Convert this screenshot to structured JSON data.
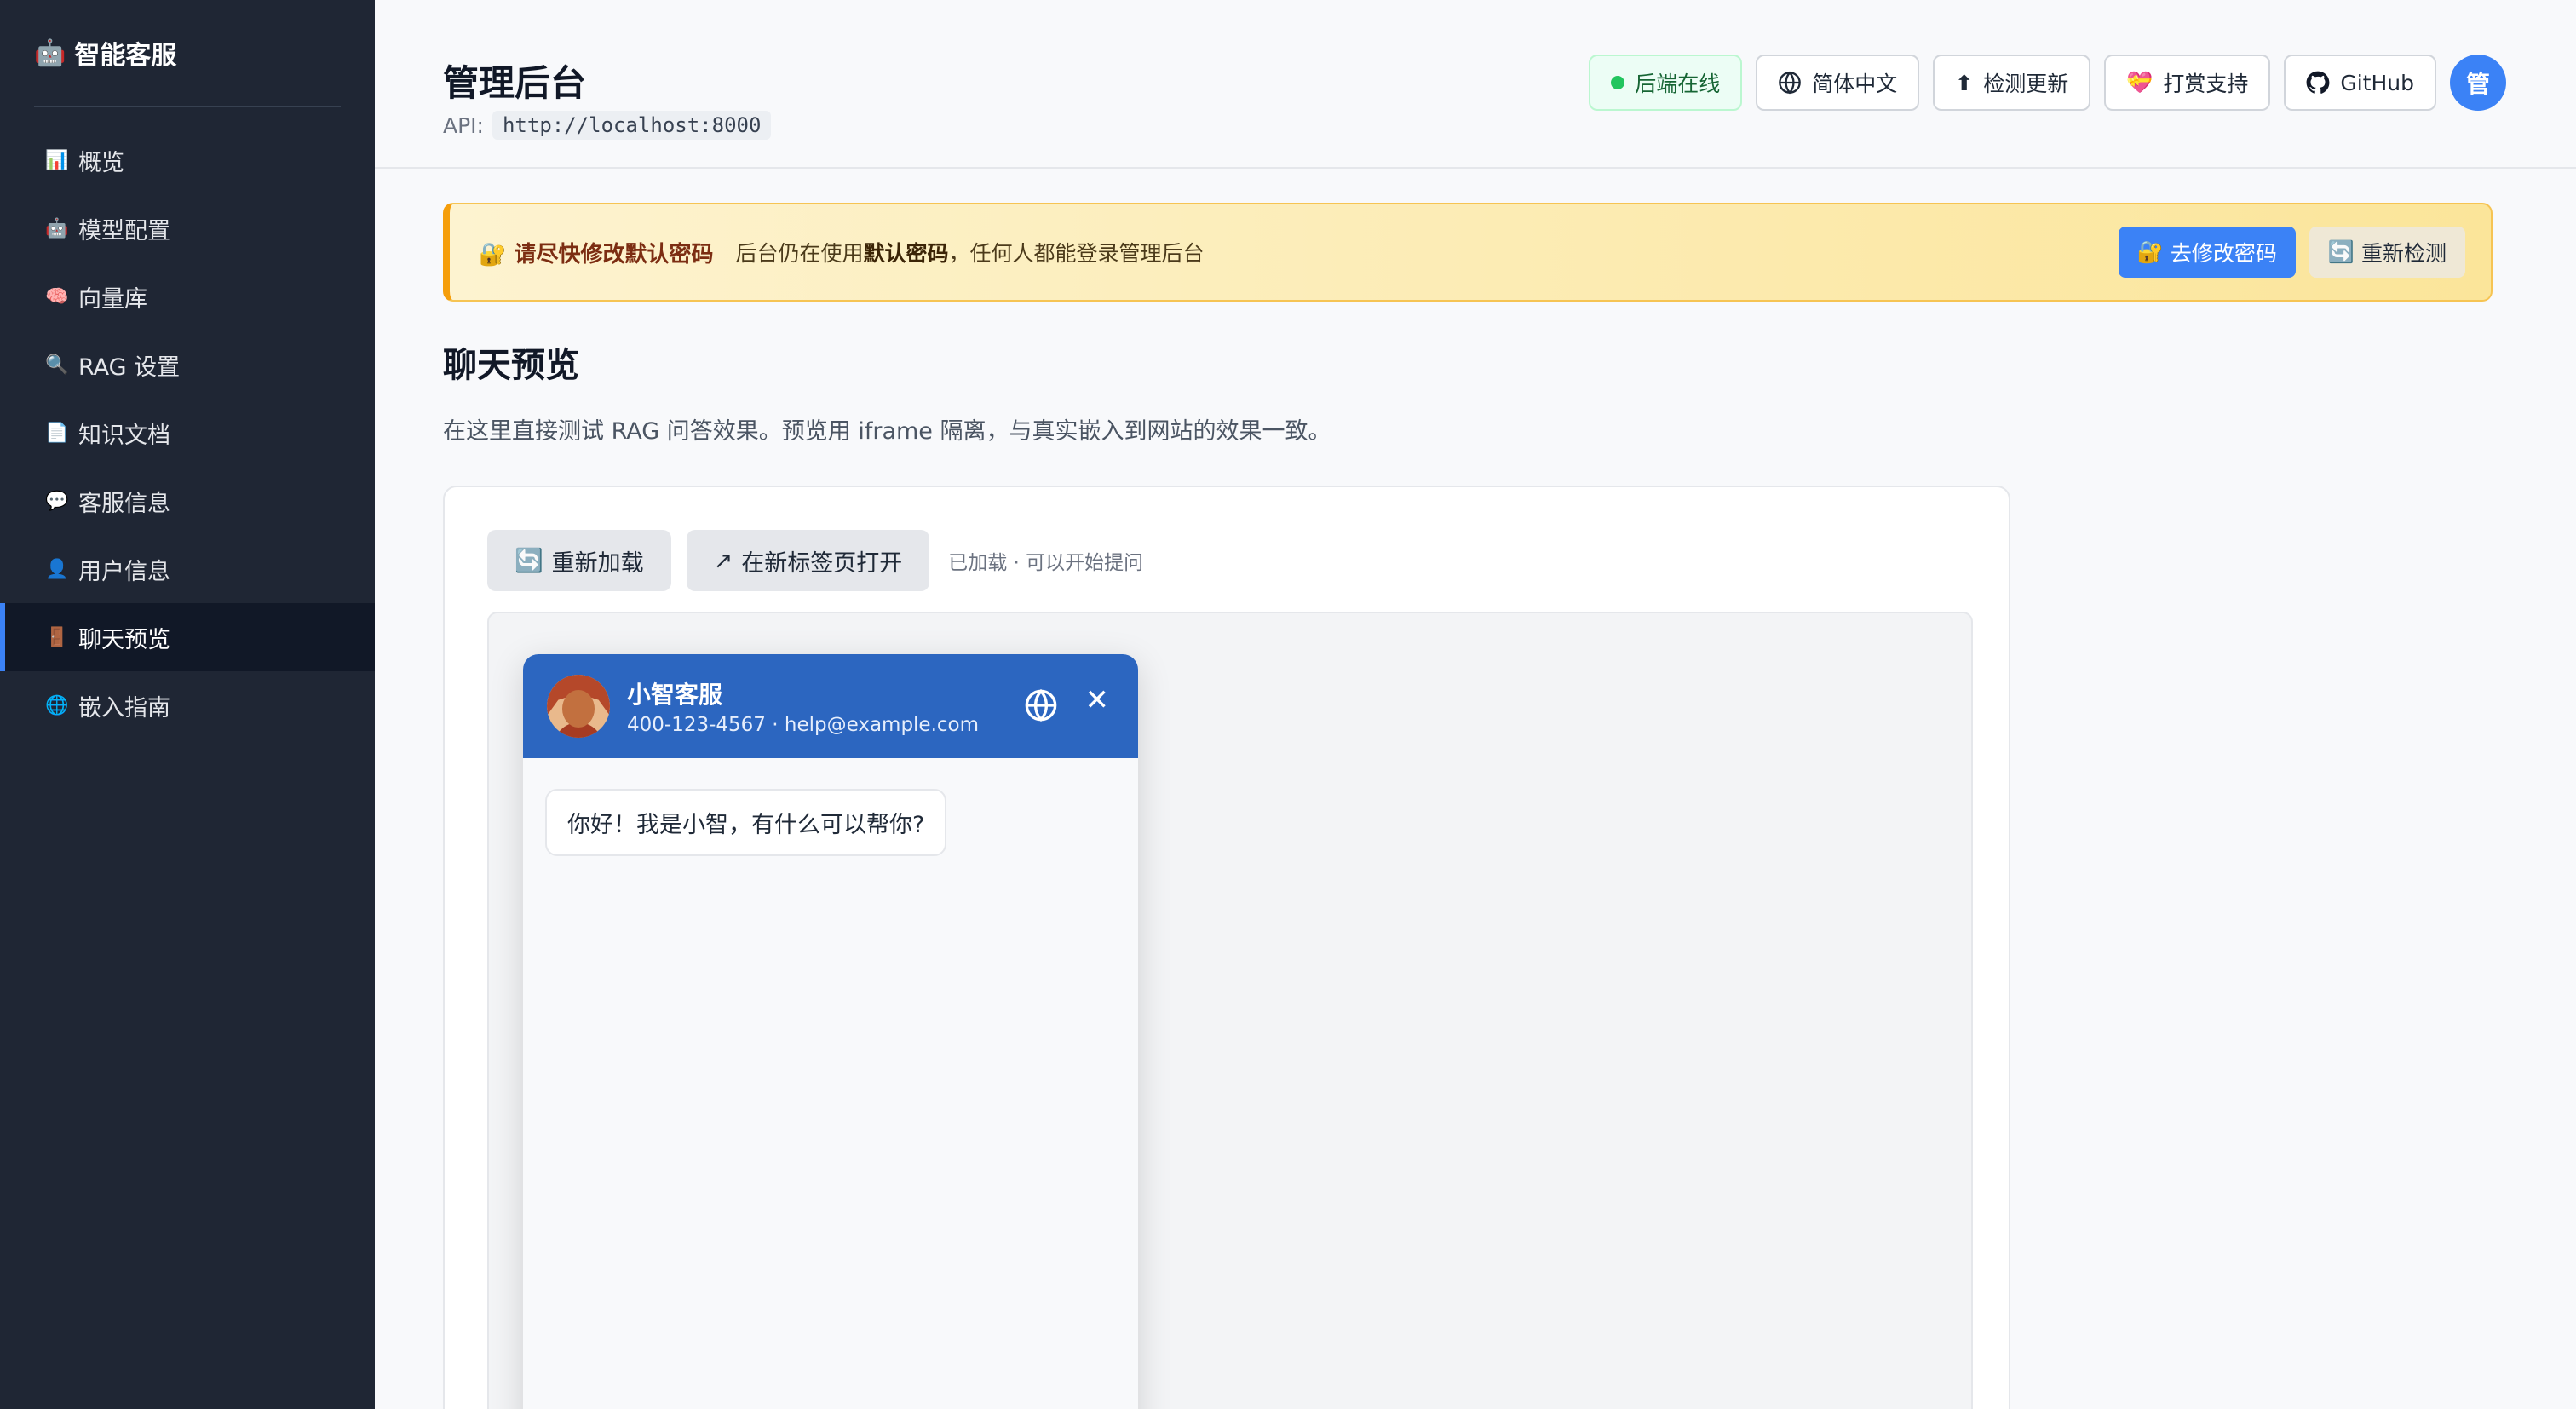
{
  "sidebar": {
    "brand_icon": "🤖",
    "brand": "智能客服",
    "items": [
      {
        "icon": "📊",
        "icon_name": "chart-icon",
        "label": "概览"
      },
      {
        "icon": "🤖",
        "icon_name": "robot-icon",
        "label": "模型配置"
      },
      {
        "icon": "🧠",
        "icon_name": "brain-icon",
        "label": "向量库"
      },
      {
        "icon": "🔍",
        "icon_name": "search-icon",
        "label": "RAG 设置"
      },
      {
        "icon": "📄",
        "icon_name": "document-icon",
        "label": "知识文档"
      },
      {
        "icon": "💬",
        "icon_name": "chat-bubble-icon",
        "label": "客服信息"
      },
      {
        "icon": "👤",
        "icon_name": "user-icon",
        "label": "用户信息"
      },
      {
        "icon": "🚪",
        "icon_name": "door-icon",
        "label": "聊天预览"
      },
      {
        "icon": "🌐",
        "icon_name": "globe-icon",
        "label": "嵌入指南"
      }
    ],
    "active_index": 7
  },
  "header": {
    "title": "管理后台",
    "api_label": "API:",
    "api_url": "http://localhost:8000",
    "status": "后端在线",
    "language": "简体中文",
    "check_update": "检测更新",
    "support": "打赏支持",
    "github": "GitHub",
    "avatar_text": "管"
  },
  "banner": {
    "icon": "🔐",
    "strong": "请尽快修改默认密码",
    "text_prefix": "后台仍在使用",
    "text_bold": "默认密码",
    "text_suffix": "，任何人都能登录管理后台",
    "change_password": "去修改密码",
    "change_password_icon": "🔐",
    "recheck": "重新检测",
    "recheck_icon": "🔄"
  },
  "section": {
    "title": "聊天预览",
    "description": "在这里直接测试 RAG 问答效果。预览用 iframe 隔离，与真实嵌入到网站的效果一致。"
  },
  "toolbar": {
    "reload_icon": "🔄",
    "reload": "重新加载",
    "open_new_tab_icon": "↗",
    "open_new_tab": "在新标签页打开",
    "status": "已加载 · 可以开始提问"
  },
  "widget": {
    "name": "小智客服",
    "contact": "400-123-4567 · help@example.com",
    "close_glyph": "✕",
    "greeting": "你好！我是小智，有什么可以帮你?"
  },
  "colors": {
    "sidebar_bg": "#1f2634",
    "accent": "#3b82f6",
    "widget_header": "#2c66c0",
    "status_green": "#22c55e"
  }
}
